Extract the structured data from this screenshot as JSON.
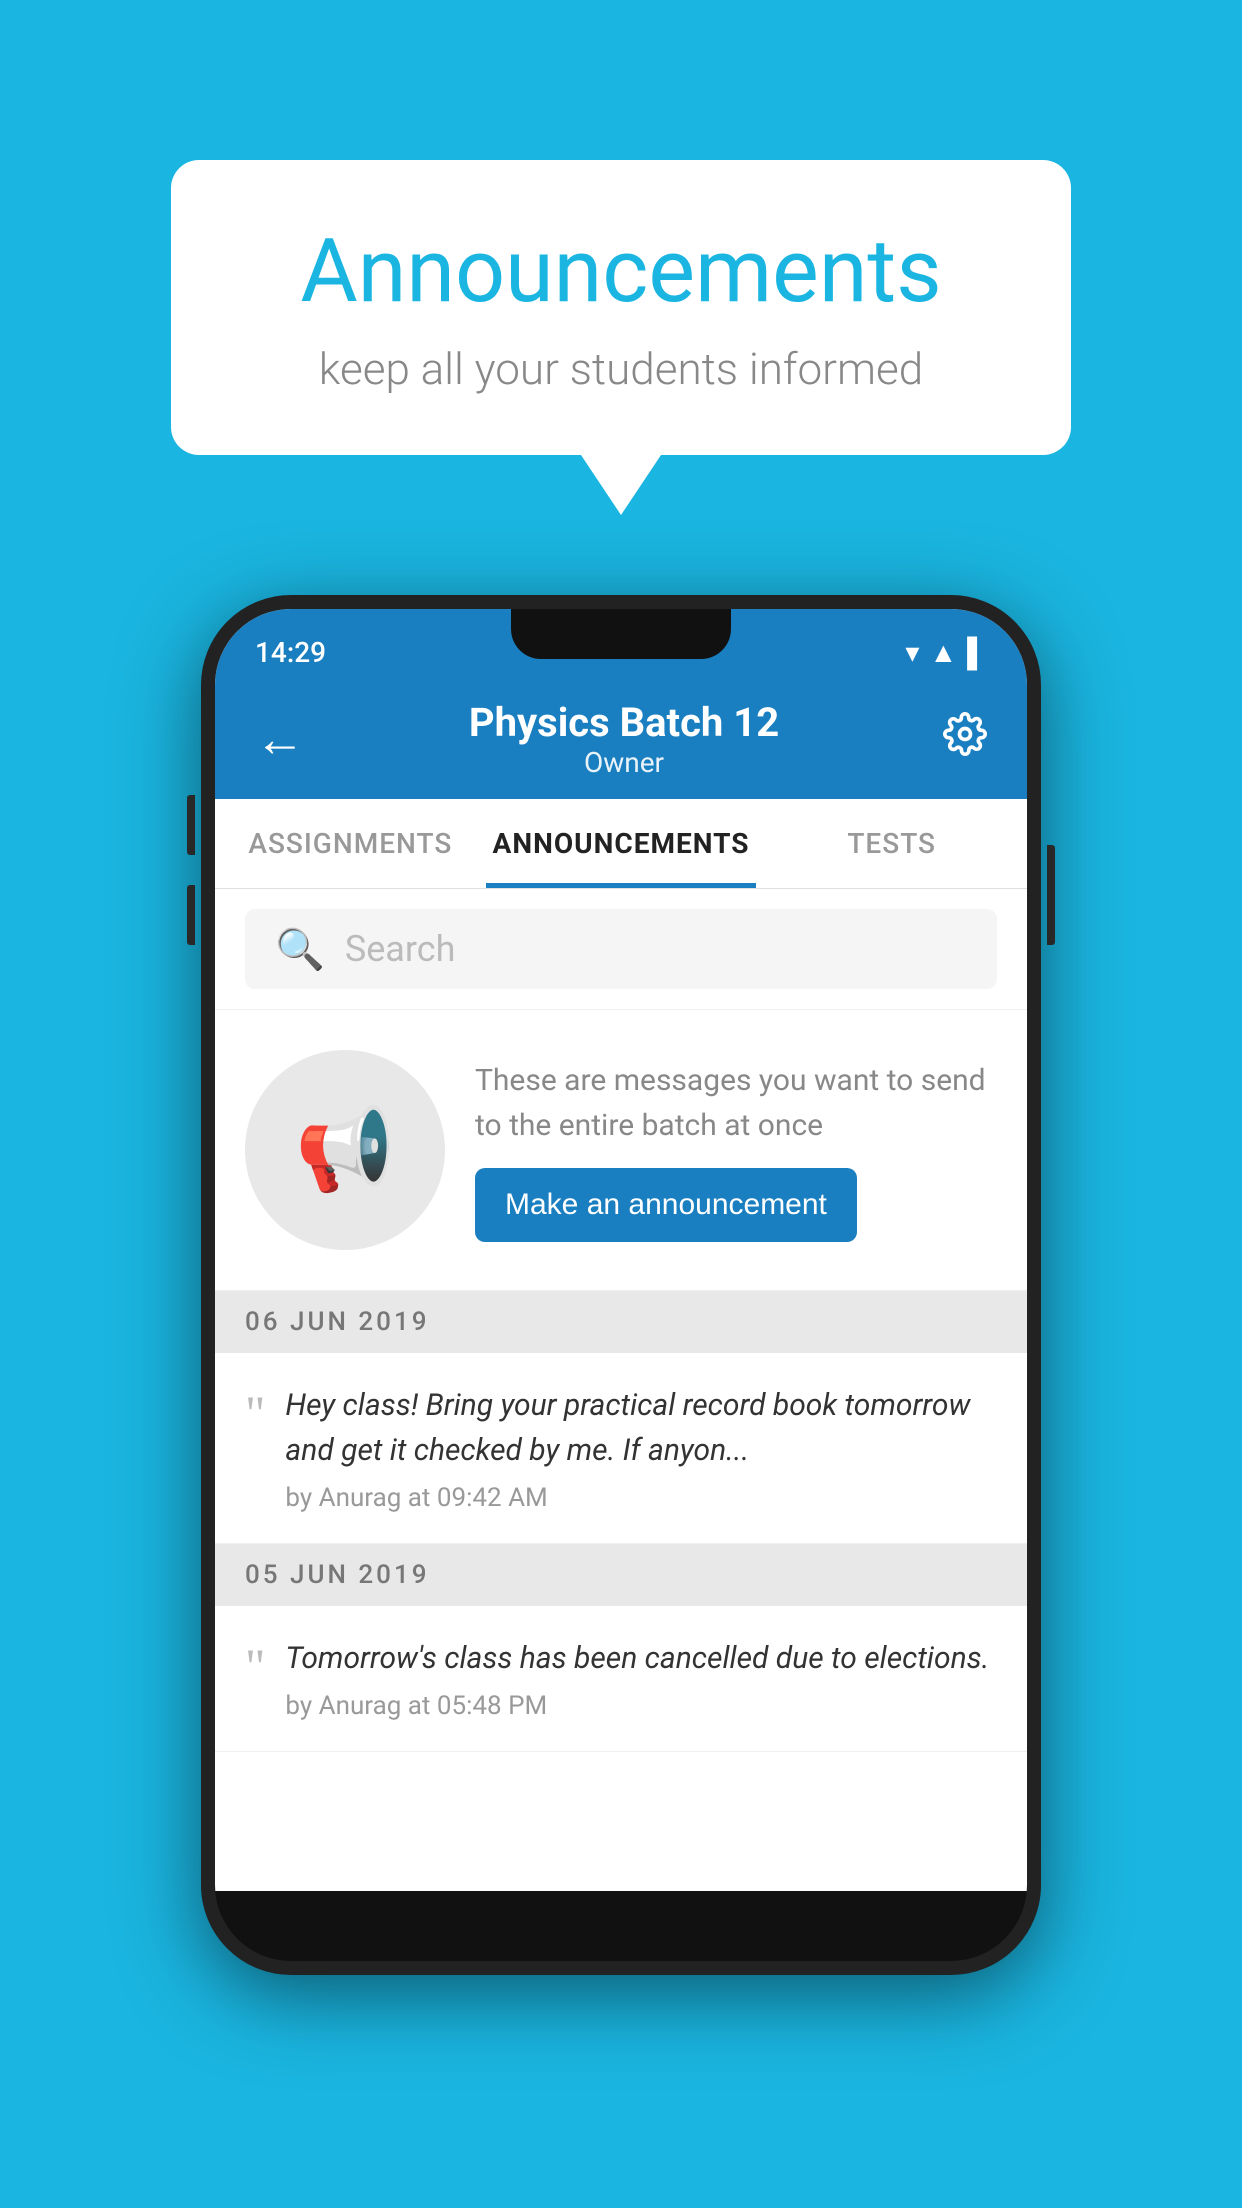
{
  "background_color": "#1ab5e0",
  "speech_bubble": {
    "title": "Announcements",
    "subtitle": "keep all your students informed"
  },
  "app_bar": {
    "title": "Physics Batch 12",
    "subtitle": "Owner",
    "back_label": "←",
    "settings_label": "⚙"
  },
  "tabs": [
    {
      "label": "ASSIGNMENTS",
      "active": false
    },
    {
      "label": "ANNOUNCEMENTS",
      "active": true
    },
    {
      "label": "TESTS",
      "active": false
    }
  ],
  "search": {
    "placeholder": "Search"
  },
  "announcement_prompt": {
    "description": "These are messages you want to send to the entire batch at once",
    "button_label": "Make an announcement"
  },
  "status_bar": {
    "time": "14:29"
  },
  "announcements": [
    {
      "date": "06  JUN  2019",
      "text": "Hey class! Bring your practical record book tomorrow and get it checked by me. If anyon...",
      "meta": "by Anurag at 09:42 AM"
    },
    {
      "date": "05  JUN  2019",
      "text": "Tomorrow's class has been cancelled due to elections.",
      "meta": "by Anurag at 05:48 PM"
    }
  ]
}
